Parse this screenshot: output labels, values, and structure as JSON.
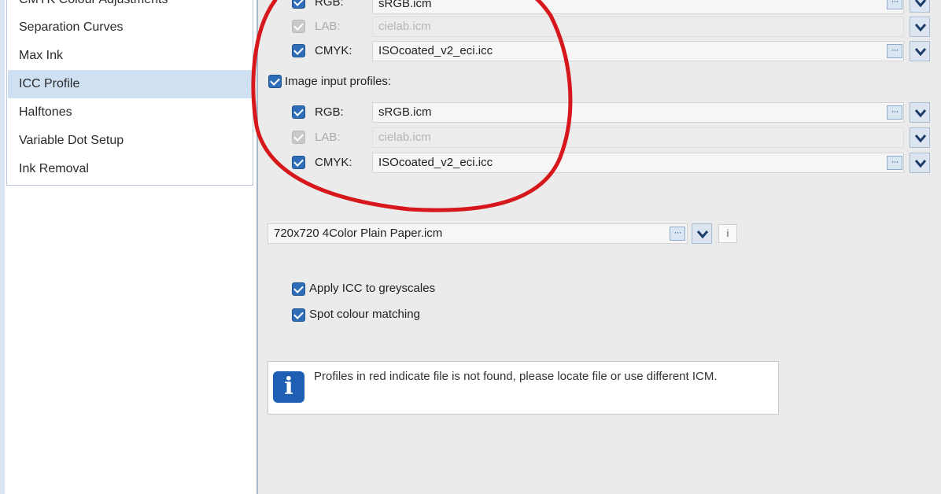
{
  "sidebar": {
    "items": [
      {
        "label": "CMYK Colour Adjustments",
        "selected": false
      },
      {
        "label": "Separation Curves",
        "selected": false
      },
      {
        "label": "Max Ink",
        "selected": false
      },
      {
        "label": "ICC Profile",
        "selected": true
      },
      {
        "label": "Halftones",
        "selected": false
      },
      {
        "label": "Variable Dot Setup",
        "selected": false
      },
      {
        "label": "Ink Removal",
        "selected": false
      }
    ]
  },
  "first_group": {
    "rgb": {
      "label": "RGB:",
      "value": "sRGB.icm",
      "checked": true
    },
    "lab": {
      "label": "LAB:",
      "value": "cielab.icm",
      "checked": true,
      "disabled": true
    },
    "cmyk": {
      "label": "CMYK:",
      "value": "ISOcoated_v2_eci.icc",
      "checked": true
    }
  },
  "image_input": {
    "label": "Image input profiles:",
    "checked": true,
    "rgb": {
      "label": "RGB:",
      "value": "sRGB.icm",
      "checked": true
    },
    "lab": {
      "label": "LAB:",
      "value": "cielab.icm",
      "checked": true,
      "disabled": true
    },
    "cmyk": {
      "label": "CMYK:",
      "value": "ISOcoated_v2_eci.icc",
      "checked": true
    }
  },
  "output_profile": {
    "value": "720x720 4Color Plain Paper.icm",
    "info_label": "i"
  },
  "options": {
    "apply_icc_greyscales": {
      "label": "Apply ICC to greyscales",
      "checked": true
    },
    "spot_colour_matching": {
      "label": "Spot colour matching",
      "checked": true
    }
  },
  "notice": {
    "text": "Profiles in red indicate file is not found, please locate file or use different ICM.",
    "icon_glyph": "i"
  },
  "browse_glyph": "···",
  "colors": {
    "selection": "#cfe0f3",
    "checkbox": "#2f6db8",
    "annotation": "#d6171c",
    "info_icon": "#1f5fb3"
  }
}
